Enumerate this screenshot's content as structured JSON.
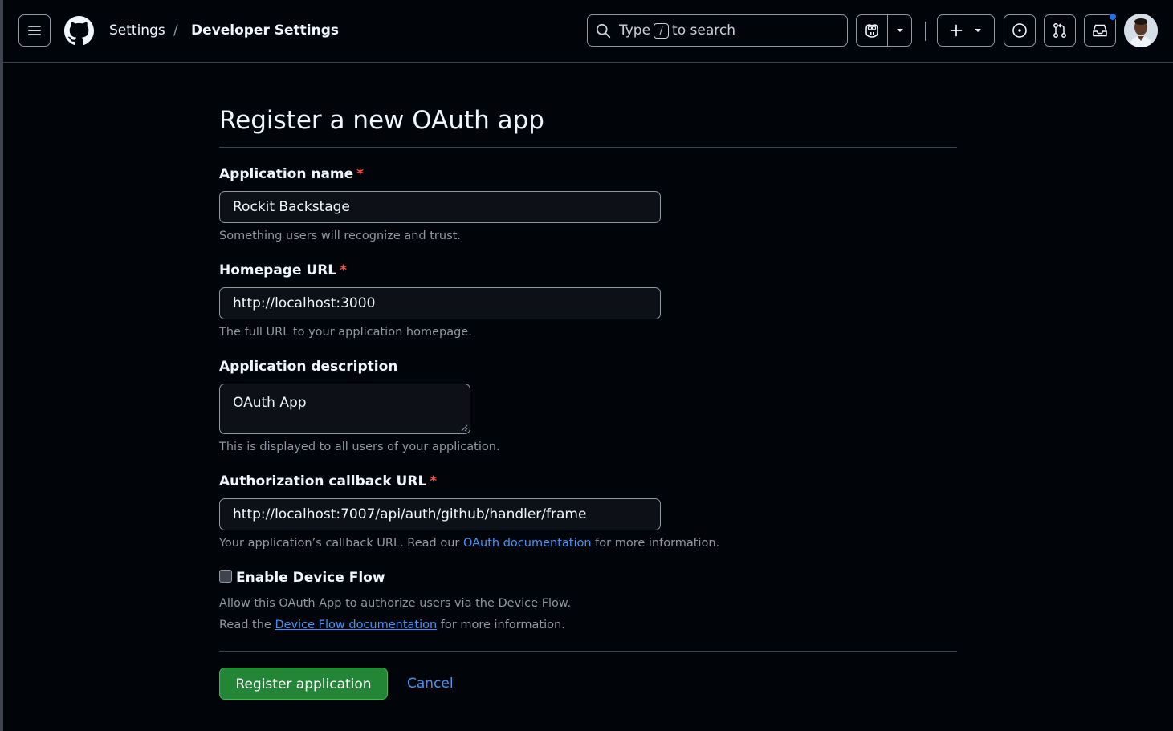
{
  "header": {
    "breadcrumb": {
      "settings": "Settings",
      "separator": "/",
      "current": "Developer Settings"
    },
    "search": {
      "type_text": "Type",
      "shortcut": "/",
      "rest_text": "to search"
    },
    "icons": [
      "hamburger-icon",
      "github-logo",
      "search-icon",
      "copilot-icon",
      "chevron-down-icon",
      "plus-icon",
      "issue-icon",
      "pull-request-icon",
      "inbox-icon"
    ],
    "notification_dot_color": "#1f6feb"
  },
  "form": {
    "title": "Register a new OAuth app",
    "app_name": {
      "label": "Application name",
      "required_marker": "*",
      "value": "Rockit Backstage",
      "note": "Something users will recognize and trust."
    },
    "homepage": {
      "label": "Homepage URL",
      "required_marker": "*",
      "value": "http://localhost:3000",
      "note": "The full URL to your application homepage."
    },
    "description": {
      "label": "Application description",
      "value": "OAuth App",
      "note": "This is displayed to all users of your application."
    },
    "callback": {
      "label": "Authorization callback URL",
      "required_marker": "*",
      "value": "http://localhost:7007/api/auth/github/handler/frame",
      "note_prefix": "Your application’s callback URL. Read our",
      "note_link": "OAuth documentation",
      "note_suffix": "for more information."
    },
    "device_flow": {
      "label": "Enable Device Flow",
      "checked": false,
      "note1": "Allow this OAuth App to authorize users via the Device Flow.",
      "note2_prefix": "Read the",
      "note2_link": "Device Flow documentation",
      "note2_suffix": "for more information."
    },
    "register_button": "Register application",
    "cancel_link": "Cancel"
  },
  "colors": {
    "background": "#010409",
    "primary_button": "#238636",
    "link": "#4493f8",
    "required": "#f85149"
  }
}
